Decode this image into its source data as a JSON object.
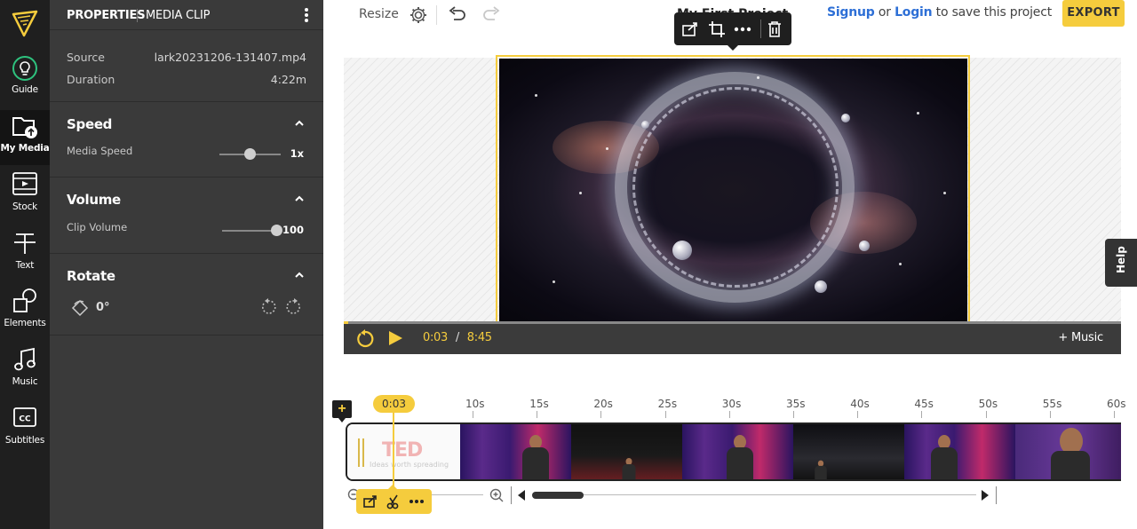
{
  "rail": {
    "items": [
      {
        "label": "Guide",
        "icon": "lightbulb-icon"
      },
      {
        "label": "My Media",
        "icon": "folder-upload-icon"
      },
      {
        "label": "Stock",
        "icon": "film-icon"
      },
      {
        "label": "Text",
        "icon": "text-icon"
      },
      {
        "label": "Elements",
        "icon": "shapes-icon"
      },
      {
        "label": "Music",
        "icon": "music-note-icon"
      },
      {
        "label": "Subtitles",
        "icon": "closed-caption-icon"
      }
    ],
    "active": "My Media"
  },
  "panel": {
    "tab_properties": "PROPERTIES",
    "tab_media_clip": "MEDIA CLIP",
    "source_label": "Source",
    "source_value": "lark20231206-131407.mp4",
    "duration_label": "Duration",
    "duration_value": "4:22m",
    "speed": {
      "title": "Speed",
      "sub_label": "Media Speed",
      "value": "1x",
      "level": 0.5
    },
    "volume": {
      "title": "Volume",
      "sub_label": "Clip Volume",
      "value": "100",
      "level": 1.0
    },
    "rotate": {
      "title": "Rotate",
      "value": "0°"
    }
  },
  "topbar": {
    "resize_label": "Resize",
    "title_peek": "My First Project",
    "signup_label": "Signup",
    "or_text": "or",
    "login_label": "Login",
    "save_text": "to save this project",
    "export_label": "EXPORT"
  },
  "player": {
    "current_time": "0:03",
    "separator": "/",
    "total_time": "8:45",
    "music_label": "+ Music",
    "progress": 0.006
  },
  "help_label": "Help",
  "timeline": {
    "add_label": "+",
    "playhead_label": "0:03",
    "ruler": [
      "10s",
      "15s",
      "20s",
      "25s",
      "30s",
      "35s",
      "40s",
      "45s",
      "50s",
      "55s",
      "60s"
    ],
    "ted_logo_text": "TED",
    "ted_tagline": "Ideas worth spreading"
  },
  "colors": {
    "accent": "#f5cc3d",
    "link": "#2d6fd6",
    "panel_bg": "#3a3a3a",
    "rail_bg": "#1f1f1f"
  }
}
